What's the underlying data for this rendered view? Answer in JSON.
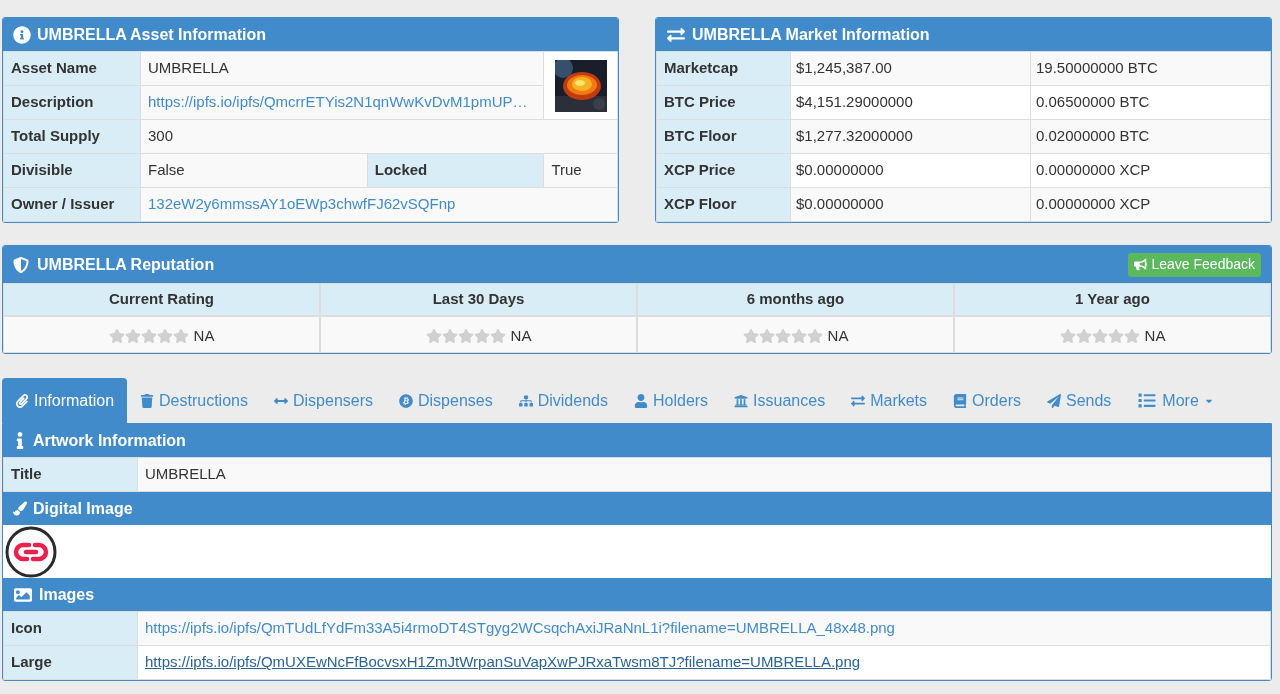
{
  "asset_info": {
    "title": "UMBRELLA Asset Information",
    "rows": [
      {
        "label": "Asset Name",
        "value": "UMBRELLA",
        "kind": "text"
      },
      {
        "label": "Description",
        "value": "https://ipfs.io/ipfs/QmcrrETYis2N1qnWwKvDvM1pmUP…",
        "kind": "link"
      },
      {
        "label": "Total Supply",
        "value": "300",
        "kind": "text"
      },
      {
        "label": "Divisible",
        "value": "False",
        "kind": "pair",
        "label_2": "Locked",
        "value_2": "True"
      },
      {
        "label": "Owner / Issuer",
        "value": "132eW2y6mmssAY1oEWp3chwfFJ62vSQFnp",
        "kind": "link"
      }
    ]
  },
  "market_info": {
    "title": "UMBRELLA Market Information",
    "rows": [
      {
        "label": "Marketcap",
        "usd": "$1,245,387.00",
        "native": "19.50000000 BTC"
      },
      {
        "label": "BTC Price",
        "usd": "$4,151.29000000",
        "native": "0.06500000 BTC"
      },
      {
        "label": "BTC Floor",
        "usd": "$1,277.32000000",
        "native": "0.02000000 BTC"
      },
      {
        "label": "XCP Price",
        "usd": "$0.00000000",
        "native": "0.00000000 XCP"
      },
      {
        "label": "XCP Floor",
        "usd": "$0.00000000",
        "native": "0.00000000 XCP"
      }
    ]
  },
  "reputation": {
    "title": "UMBRELLA Reputation",
    "button": "Leave Feedback",
    "columns": [
      {
        "heading": "Current Rating",
        "stars": 0,
        "value": "NA"
      },
      {
        "heading": "Last 30 Days",
        "stars": 0,
        "value": "NA"
      },
      {
        "heading": "6 months ago",
        "stars": 0,
        "value": "NA"
      },
      {
        "heading": "1 Year ago",
        "stars": 0,
        "value": "NA"
      }
    ]
  },
  "tabs": [
    {
      "label": "Information",
      "selected": true,
      "dropdown": false
    },
    {
      "label": "Destructions",
      "selected": false,
      "dropdown": false
    },
    {
      "label": "Dispensers",
      "selected": false,
      "dropdown": false
    },
    {
      "label": "Dispenses",
      "selected": false,
      "dropdown": false
    },
    {
      "label": "Dividends",
      "selected": false,
      "dropdown": false
    },
    {
      "label": "Holders",
      "selected": false,
      "dropdown": false
    },
    {
      "label": "Issuances",
      "selected": false,
      "dropdown": false
    },
    {
      "label": "Markets",
      "selected": false,
      "dropdown": false
    },
    {
      "label": "Orders",
      "selected": false,
      "dropdown": false
    },
    {
      "label": "Sends",
      "selected": false,
      "dropdown": false
    },
    {
      "label": "More",
      "selected": false,
      "dropdown": true
    }
  ],
  "sections": [
    {
      "title": "Artwork Information",
      "kind": "table",
      "rows": [
        {
          "label": "Title",
          "value": "UMBRELLA",
          "link": false,
          "hovered": false
        }
      ]
    },
    {
      "title": "Digital Image",
      "kind": "media"
    },
    {
      "title": "Images",
      "kind": "table",
      "rows": [
        {
          "label": "Icon",
          "value": "https://ipfs.io/ipfs/QmTUdLfYdFm33A5i4rmoDT4STgyg2WCsqchAxiJRaNnL1i?filename=UMBRELLA_48x48.png",
          "link": true,
          "hovered": false
        },
        {
          "label": "Large",
          "value": "https://ipfs.io/ipfs/QmUXEwNcFfBocvsxH1ZmJtWrpanSuVapXwPJRxaTwsm8TJ?filename=UMBRELLA.png",
          "link": true,
          "hovered": true
        }
      ]
    }
  ]
}
